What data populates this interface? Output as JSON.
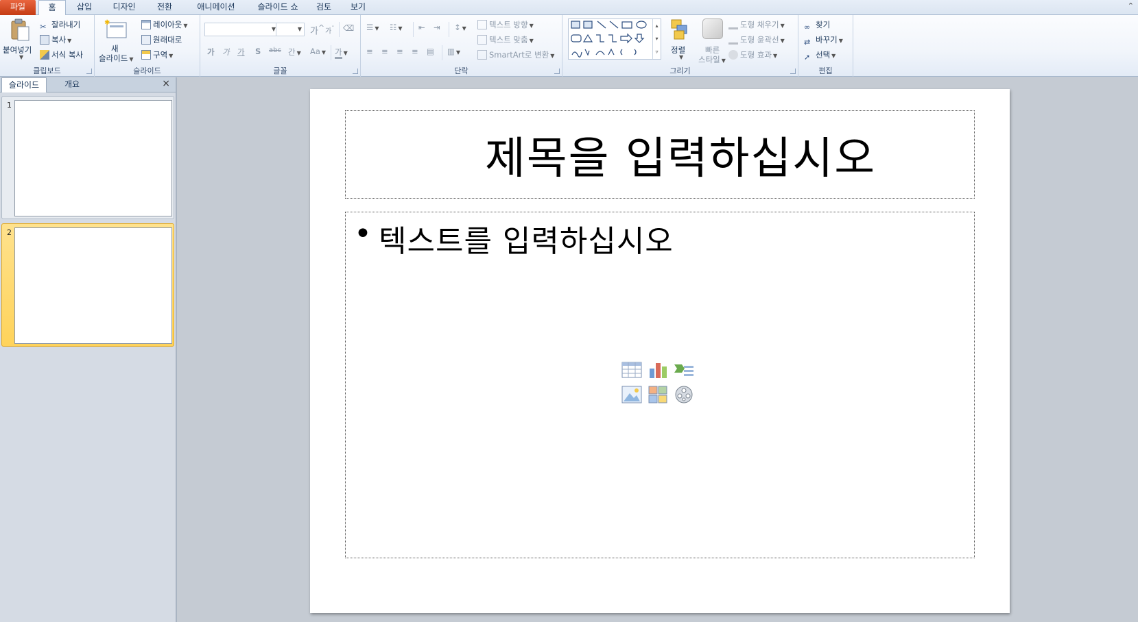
{
  "tabs": [
    "파일",
    "홈",
    "삽입",
    "디자인",
    "전환",
    "애니메이션",
    "슬라이드 쇼",
    "검토",
    "보기"
  ],
  "collapse_icon": "chevron-up-icon",
  "clipboard": {
    "paste": "붙여넣기",
    "cut": "잘라내기",
    "copy": "복사",
    "format_painter": "서식 복사",
    "label": "클립보드"
  },
  "slides_group": {
    "new_slide_1": "새",
    "new_slide_2": "슬라이드",
    "layout": "레이아웃",
    "reset": "원래대로",
    "section": "구역",
    "label": "슬라이드"
  },
  "font_group": {
    "font_name": "",
    "font_size": "",
    "grow": "가",
    "shrink": "가",
    "bold": "가",
    "italic": "가",
    "underline": "가",
    "shadow": "S",
    "strike": "abc",
    "spacing": "간",
    "case": "Aa",
    "color": "가",
    "label": "글꼴"
  },
  "paragraph_group": {
    "text_direction": "텍스트 방향",
    "align_text": "텍스트 맞춤",
    "smartart": "SmartArt로 변환",
    "label": "단락"
  },
  "drawing_group": {
    "arrange": "정렬",
    "quick_styles_1": "빠른",
    "quick_styles_2": "스타일",
    "shape_fill": "도형 채우기",
    "shape_outline": "도형 윤곽선",
    "shape_effects": "도형 효과",
    "label": "그리기"
  },
  "editing_group": {
    "find": "찾기",
    "replace": "바꾸기",
    "select": "선택",
    "label": "편집"
  },
  "left_pane": {
    "tab_slides": "슬라이드",
    "tab_outline": "개요",
    "close": "×",
    "thumbnails": [
      "1",
      "2"
    ]
  },
  "slide": {
    "title_placeholder": "제목을 입력하십시오",
    "bullet": "•",
    "body_placeholder": "텍스트를 입력하십시오"
  },
  "colors": {
    "file_tab": "#d24726",
    "selected_thumb": "#ffd35a",
    "ribbon_bg": "#f1f5fb"
  }
}
